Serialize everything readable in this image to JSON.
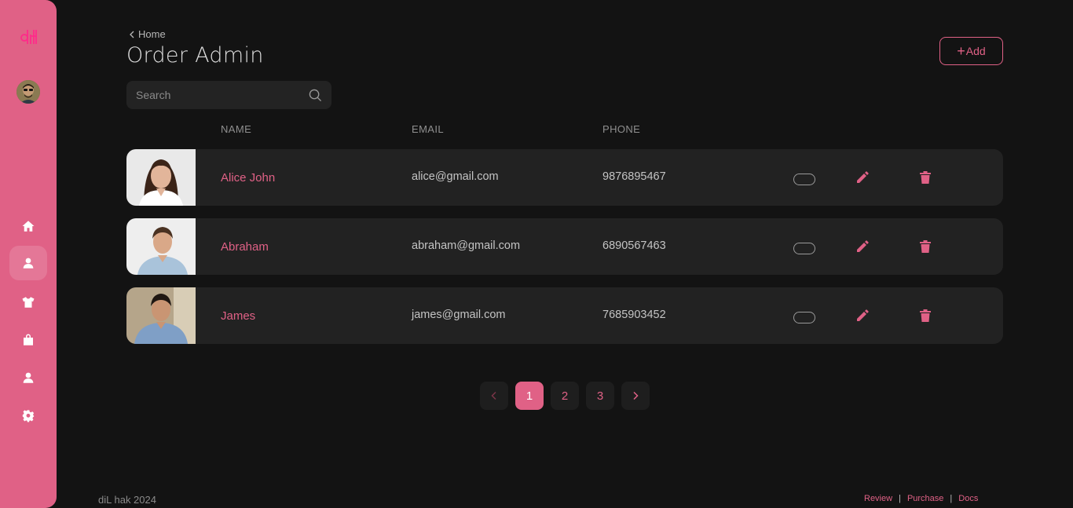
{
  "brand": {
    "logo_text": "diL",
    "accent": "#e06186"
  },
  "sidebar": {
    "items": [
      {
        "name": "home",
        "icon": "home-icon",
        "active": false
      },
      {
        "name": "users",
        "icon": "user-icon",
        "active": true
      },
      {
        "name": "products",
        "icon": "shirt-icon",
        "active": false
      },
      {
        "name": "orders",
        "icon": "bag-icon",
        "active": false
      },
      {
        "name": "profile",
        "icon": "user-icon",
        "active": false
      },
      {
        "name": "settings",
        "icon": "gear-icon",
        "active": false
      }
    ]
  },
  "header": {
    "breadcrumb": "Home",
    "title": "Order Admin",
    "add_label": "Add"
  },
  "search": {
    "placeholder": "Search",
    "value": ""
  },
  "table": {
    "columns": [
      "NAME",
      "EMAIL",
      "PHONE"
    ],
    "rows": [
      {
        "name": "Alice John",
        "email": "alice@gmail.com",
        "phone": "9876895467"
      },
      {
        "name": "Abraham",
        "email": "abraham@gmail.com",
        "phone": "6890567463"
      },
      {
        "name": "James",
        "email": "james@gmail.com",
        "phone": "7685903452"
      }
    ]
  },
  "pagination": {
    "pages": [
      "1",
      "2",
      "3"
    ],
    "current": "1"
  },
  "footer": {
    "copyright": "diL hak 2024",
    "links": [
      "Review",
      "Purchase",
      "Docs"
    ],
    "separator": "|"
  }
}
